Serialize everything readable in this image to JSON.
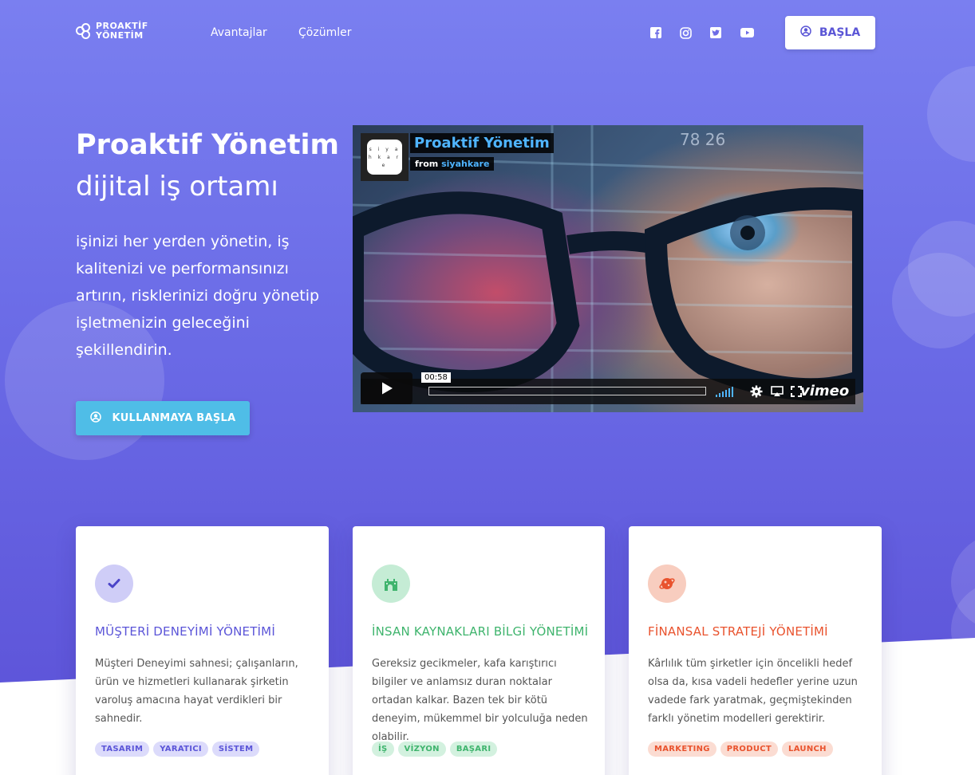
{
  "nav": {
    "logo_line1": "PROAKTİF",
    "logo_line2": "YÖNETİM",
    "links": [
      "Avantajlar",
      "Çözümler"
    ],
    "social_icons": [
      "facebook-icon",
      "instagram-icon",
      "twitter-icon",
      "youtube-icon"
    ],
    "start_button": "BAŞLA"
  },
  "hero": {
    "title": "Proaktif Yönetim",
    "subtitle": "dijital iş ortamı",
    "description": "işinizi her yerden yönetin, iş kalitenizi ve performansınızı artırın, risklerinizi doğru yönetip işletmenizin geleceğini şekillendirin.",
    "cta": "KULLANMAYA BAŞLA"
  },
  "video": {
    "title": "Proaktif Yönetim",
    "from_label": "from",
    "from_author": "siyahkare",
    "badge_text": "s i y a h k a r e",
    "time": "00:58",
    "player_brand": "vimeo"
  },
  "cards": [
    {
      "title": "MÜŞTERİ DENEYİMİ YÖNETİMİ",
      "description": "Müşteri Deneyimi sahnesi; çalışanların, ürün ve hizmetleri kullanarak şirketin varoluş amacına hayat verdikleri bir sahnedir.",
      "tags": [
        "TASARIM",
        "YARATICI",
        "SİSTEM"
      ],
      "accent": "#5b55d8",
      "icon_bg": "#cfcdf7",
      "tag_bg": "#dcdbfb"
    },
    {
      "title": "İNSAN KAYNAKLARI BİLGİ YÖNETİMİ",
      "description": "Gereksiz gecikmeler, kafa karıştırıcı bilgiler ve anlamsız duran noktalar ortadan kalkar. Bazen tek bir kötü deneyim, mükemmel bir yolculuğa neden olabilir.",
      "tags": [
        "İŞ",
        "VİZYON",
        "BAŞARI"
      ],
      "accent": "#3fb46d",
      "icon_bg": "#c5ecd5",
      "tag_bg": "#d3f1df"
    },
    {
      "title": "FİNANSAL STRATEJİ YÖNETİMİ",
      "description": "Kârlılık tüm şirketler için öncelikli hedef olsa da, kısa vadeli hedefler yerine uzun vadede fark yaratmak, geçmiştekinden farklı yönetim modelleri gerektirir.",
      "tags": [
        "MARKETING",
        "PRODUCT",
        "LAUNCH"
      ],
      "accent": "#e9532e",
      "icon_bg": "#f8cdbf",
      "tag_bg": "#fbdcd2"
    }
  ]
}
